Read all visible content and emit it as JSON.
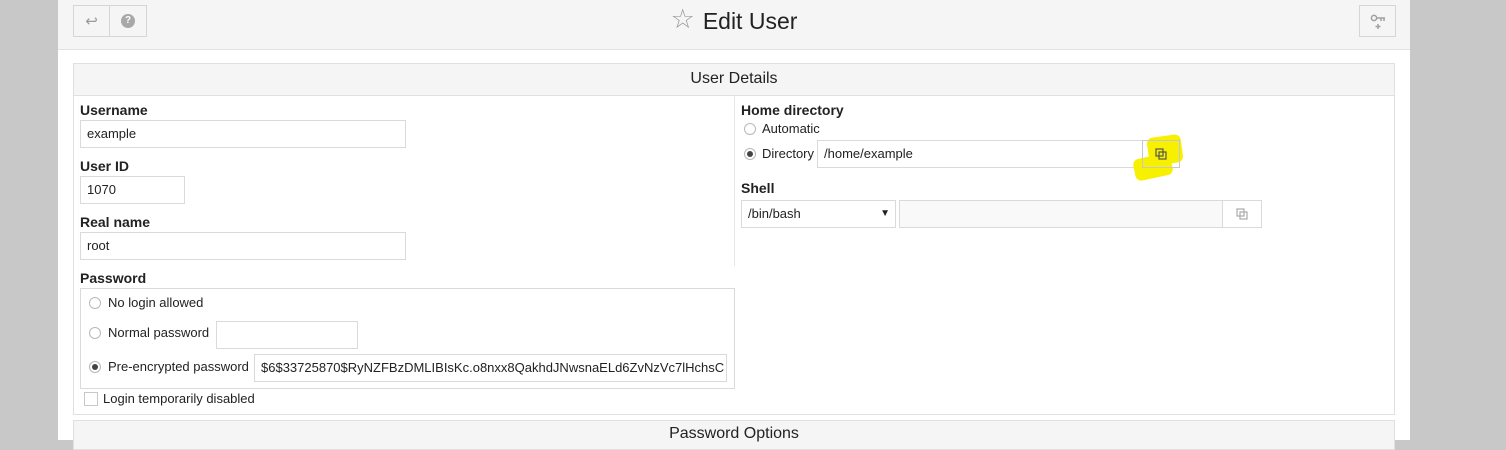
{
  "header": {
    "title": "Edit User",
    "back_icon": "↩",
    "help_icon": "?",
    "key_icon": "key-plus"
  },
  "user_details": {
    "section_title": "User Details",
    "username": {
      "label": "Username",
      "value": "example"
    },
    "user_id": {
      "label": "User ID",
      "value": "1070"
    },
    "real_name": {
      "label": "Real name",
      "value": "root"
    },
    "password": {
      "label": "Password",
      "options": [
        {
          "label": "No login allowed",
          "checked": false
        },
        {
          "label": "Normal password",
          "checked": false,
          "value": ""
        },
        {
          "label": "Pre-encrypted password",
          "checked": true,
          "value": "$6$33725870$RyNZFBzDMLIBIsKc.o8nxx8QakhdJNwsnaELd6ZvNzVc7lHchsC"
        }
      ],
      "login_disabled_label": "Login temporarily disabled",
      "login_disabled": false
    },
    "home_directory": {
      "label": "Home directory",
      "automatic_label": "Automatic",
      "directory_label": "Directory",
      "directory_value": "/home/example",
      "selected": "Directory"
    },
    "shell": {
      "label": "Shell",
      "selected": "/bin/bash",
      "custom_value": ""
    }
  },
  "password_options": {
    "section_title": "Password Options"
  },
  "colors": {
    "highlight": "#f7f000",
    "header_bg": "#f5f5f5"
  }
}
